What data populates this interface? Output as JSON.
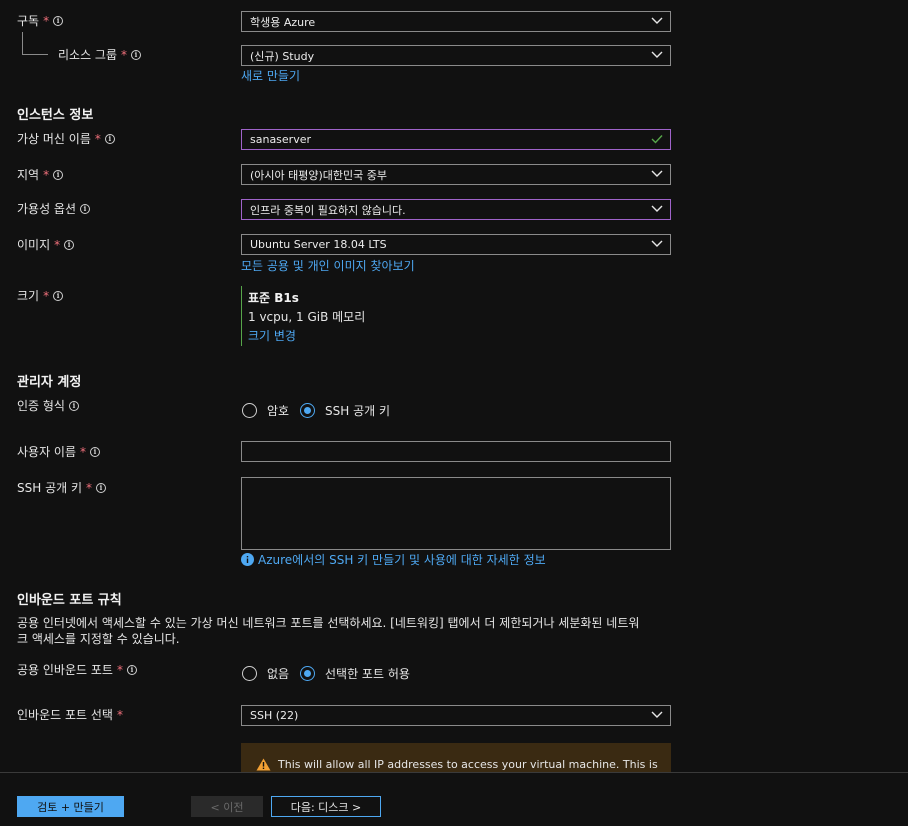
{
  "subscription": {
    "label": "구독",
    "value": "학생용 Azure"
  },
  "resource_group": {
    "label": "리소스 그룹",
    "value": "(신규) Study",
    "create_new": "새로 만들기"
  },
  "instance_section": {
    "title": "인스턴스 정보"
  },
  "vm_name": {
    "label": "가상 머신 이름",
    "value": "sanaserver"
  },
  "region": {
    "label": "지역",
    "value": "(아시아 태평양)대한민국 중부"
  },
  "availability": {
    "label": "가용성 옵션",
    "value": "인프라 중복이 필요하지 않습니다."
  },
  "image": {
    "label": "이미지",
    "value": "Ubuntu Server 18.04 LTS",
    "browse_link": "모든 공용 및 개인 이미지 찾아보기"
  },
  "size": {
    "label": "크기",
    "name": "표준 B1s",
    "detail": "1 vcpu, 1 GiB 메모리",
    "change_link": "크기 변경"
  },
  "admin_section": {
    "title": "관리자 계정"
  },
  "auth_type": {
    "label": "인증 형식",
    "option_password": "암호",
    "option_ssh": "SSH 공개 키",
    "selected": "SSH 공개 키"
  },
  "username": {
    "label": "사용자 이름",
    "value": ""
  },
  "ssh_key": {
    "label": "SSH 공개 키",
    "value": "",
    "info_link": "Azure에서의 SSH 키 만들기 및 사용에 대한 자세한 정보"
  },
  "inbound_section": {
    "title": "인바운드 포트 규칙",
    "desc_line1": "공용 인터넷에서 액세스할 수 있는 가상 머신 네트워크 포트를 선택하세요. [네트워킹] 탭에서 더 제한되거나 세분화된 네트워",
    "desc_line2": "크 액세스를 지정할 수 있습니다."
  },
  "public_ports": {
    "label": "공용 인바운드 포트",
    "option_none": "없음",
    "option_allow": "선택한 포트 허용",
    "selected": "선택한 포트 허용"
  },
  "inbound_select": {
    "label": "인바운드 포트 선택",
    "value": "SSH (22)"
  },
  "warning": {
    "text": "This will allow all IP addresses to access your virtual machine.  This is"
  },
  "footer": {
    "review_create": "검토 + 만들기",
    "previous": "< 이전",
    "next": "다음: 디스크 >"
  },
  "colors": {
    "accent": "#4ea8f2",
    "required": "#f1707b",
    "focus_border": "#9f63c9",
    "valid_check": "#57a64a",
    "warning_bg": "#3a2a12",
    "warning_icon": "#f2a033"
  }
}
